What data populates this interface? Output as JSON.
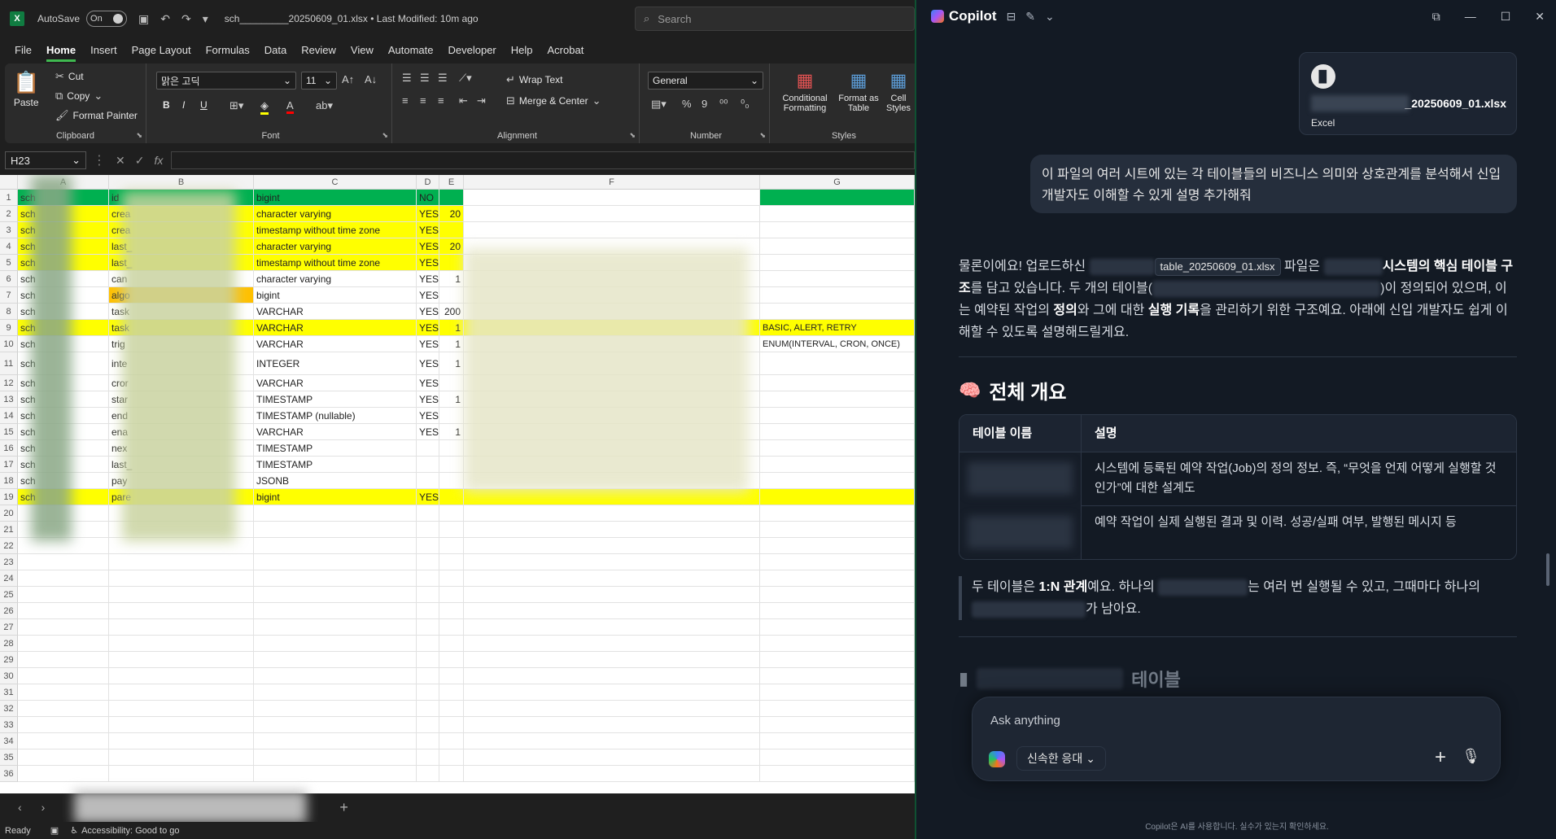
{
  "excel": {
    "titlebar": {
      "autosave_label": "AutoSave",
      "toggle_state": "On",
      "filename": "sch_________20250609_01.xlsx • Last Modified: 10m ago",
      "search_placeholder": "Search"
    },
    "menu": [
      "File",
      "Home",
      "Insert",
      "Page Layout",
      "Formulas",
      "Data",
      "Review",
      "View",
      "Automate",
      "Developer",
      "Help",
      "Acrobat"
    ],
    "ribbon": {
      "clipboard": {
        "paste": "Paste",
        "cut": "Cut",
        "copy": "Copy",
        "format_painter": "Format Painter",
        "label": "Clipboard"
      },
      "font": {
        "name": "맑은 고딕",
        "size": "11",
        "bold": "B",
        "italic": "I",
        "underline": "U",
        "label": "Font"
      },
      "alignment": {
        "wrap_text": "Wrap Text",
        "merge_center": "Merge & Center",
        "label": "Alignment"
      },
      "number": {
        "format": "General",
        "percent": "%",
        "comma": "9",
        "label": "Number"
      },
      "styles": {
        "conditional": "Conditional Formatting",
        "format_table": "Format as Table",
        "cell_styles": "Cell Styles",
        "label": "Styles"
      }
    },
    "namebox": "H23",
    "fx": "fx",
    "columns": [
      "A",
      "B",
      "C",
      "D",
      "E",
      "F",
      "G"
    ],
    "rows": [
      {
        "n": "1",
        "a": "sch",
        "b": "id",
        "c": "bigint",
        "d": "NO",
        "e": "",
        "g": "",
        "hl": "green"
      },
      {
        "n": "2",
        "a": "sch",
        "b": "crea",
        "c": "character varying",
        "d": "YES",
        "e": "20",
        "g": "",
        "hl": "yellow"
      },
      {
        "n": "3",
        "a": "sch",
        "b": "crea",
        "c": "timestamp without time zone",
        "d": "YES",
        "e": "",
        "g": "",
        "hl": "yellow"
      },
      {
        "n": "4",
        "a": "sch",
        "b": "last_",
        "c": "character varying",
        "d": "YES",
        "e": "20",
        "g": "",
        "hl": "yellow"
      },
      {
        "n": "5",
        "a": "sch",
        "b": "last_",
        "c": "timestamp without time zone",
        "d": "YES",
        "e": "",
        "g": "",
        "hl": "yellow"
      },
      {
        "n": "6",
        "a": "sch",
        "b": "can",
        "c": "character varying",
        "d": "YES",
        "e": "1",
        "g": "",
        "hl": ""
      },
      {
        "n": "7",
        "a": "sch",
        "b": "algo",
        "c": "bigint",
        "d": "YES",
        "e": "",
        "g": "",
        "hl": "orange"
      },
      {
        "n": "8",
        "a": "sch",
        "b": "task",
        "c": "VARCHAR",
        "d": "YES",
        "e": "200",
        "g": "",
        "hl": ""
      },
      {
        "n": "9",
        "a": "sch",
        "b": "task",
        "c": "VARCHAR",
        "d": "YES",
        "e": "1",
        "g": "BASIC, ALERT, RETRY",
        "hl": "yellow"
      },
      {
        "n": "10",
        "a": "sch",
        "b": "trig",
        "c": "VARCHAR",
        "d": "YES",
        "e": "1",
        "g": "ENUM(INTERVAL, CRON, ONCE)",
        "hl": ""
      },
      {
        "n": "11",
        "a": "sch",
        "b": "inte",
        "c": "INTEGER",
        "d": "YES",
        "e": "1",
        "g": "",
        "hl": "",
        "tall": true
      },
      {
        "n": "12",
        "a": "sch",
        "b": "cror",
        "c": "VARCHAR",
        "d": "YES",
        "e": "",
        "g": "",
        "hl": ""
      },
      {
        "n": "13",
        "a": "sch",
        "b": "star",
        "c": "TIMESTAMP",
        "d": "YES",
        "e": "1",
        "g": "",
        "hl": ""
      },
      {
        "n": "14",
        "a": "sch",
        "b": "end",
        "c": "TIMESTAMP (nullable)",
        "d": "YES",
        "e": "",
        "g": "",
        "hl": ""
      },
      {
        "n": "15",
        "a": "sch",
        "b": "ena",
        "c": "VARCHAR",
        "d": "YES",
        "e": "1",
        "g": "",
        "hl": ""
      },
      {
        "n": "16",
        "a": "sch",
        "b": "nex",
        "c": "TIMESTAMP",
        "d": "",
        "e": "",
        "g": "",
        "hl": ""
      },
      {
        "n": "17",
        "a": "sch",
        "b": "last_",
        "c": "TIMESTAMP",
        "d": "",
        "e": "",
        "g": "",
        "hl": ""
      },
      {
        "n": "18",
        "a": "sch",
        "b": "pay",
        "c": "JSONB",
        "d": "",
        "e": "",
        "g": "",
        "hl": ""
      },
      {
        "n": "19",
        "a": "sch",
        "b": "pare",
        "c": "bigint",
        "d": "YES",
        "e": "",
        "g": "",
        "hl": "yellow"
      },
      {
        "n": "20"
      },
      {
        "n": "21"
      },
      {
        "n": "22"
      },
      {
        "n": "23"
      },
      {
        "n": "24"
      },
      {
        "n": "25"
      },
      {
        "n": "26"
      },
      {
        "n": "27"
      },
      {
        "n": "28"
      },
      {
        "n": "29"
      },
      {
        "n": "30"
      },
      {
        "n": "31"
      },
      {
        "n": "32"
      },
      {
        "n": "33"
      },
      {
        "n": "34"
      },
      {
        "n": "35"
      },
      {
        "n": "36"
      }
    ],
    "status": {
      "ready": "Ready",
      "accessibility": "Accessibility: Good to go"
    },
    "colors": {
      "green": "#00b050",
      "yellow": "#ffff00",
      "orange": "#ffc000"
    }
  },
  "copilot": {
    "title": "Copilot",
    "file": {
      "name": "_20250609_01.xlsx",
      "type": "Excel"
    },
    "user_message": "이 파일의 여러 시트에 있는 각 테이블들의 비즈니스 의미와 상호관계를 분석해서 신입 개발자도 이해할 수 있게 설명 추가해줘",
    "answer": {
      "p1_a": "물론이에요! 업로드하신 ",
      "chip": "table_20250609_01.xlsx",
      "p1_b": " 파일은 ",
      "p1_bold1": "시스템의 핵심 테이블 구조",
      "p1_c": "를 담고 있습니다. 두 개의 테이블(",
      "p1_d": ")이 정의되어 있으며, 이는 예약된 작업의 ",
      "p1_bold2": "정의",
      "p1_e": "와 그에 대한 ",
      "p1_bold3": "실행 기록",
      "p1_f": "을 관리하기 위한 구조예요. 아래에 신입 개발자도 쉽게 이해할 수 있도록 설명해드릴게요."
    },
    "section_title": "전체 개요",
    "section_emoji": "🧠",
    "table": {
      "headers": [
        "테이블 이름",
        "설명"
      ],
      "rows": [
        "시스템에 등록된 예약 작업(Job)의 정의 정보. 즉, “무엇을 언제 어떻게 실행할 것인가”에 대한 설계도",
        "예약 작업이 실제 실행된 결과 및 이력. 성공/실패 여부, 발행된 메시지 등"
      ]
    },
    "quote": {
      "a": "두 테이블은 ",
      "bold": "1:N 관계",
      "b": "예요. 하나의 ",
      "c": "는 여러 번 실행될 수 있고, 그때마다 하나의 ",
      "d": "가 남아요."
    },
    "next_title_suffix": "테이블",
    "composer": {
      "placeholder": "Ask anything",
      "mode": "신속한 응대"
    },
    "disclaimer": "Copilot은 AI를 사용합니다. 실수가 있는지 확인하세요."
  }
}
